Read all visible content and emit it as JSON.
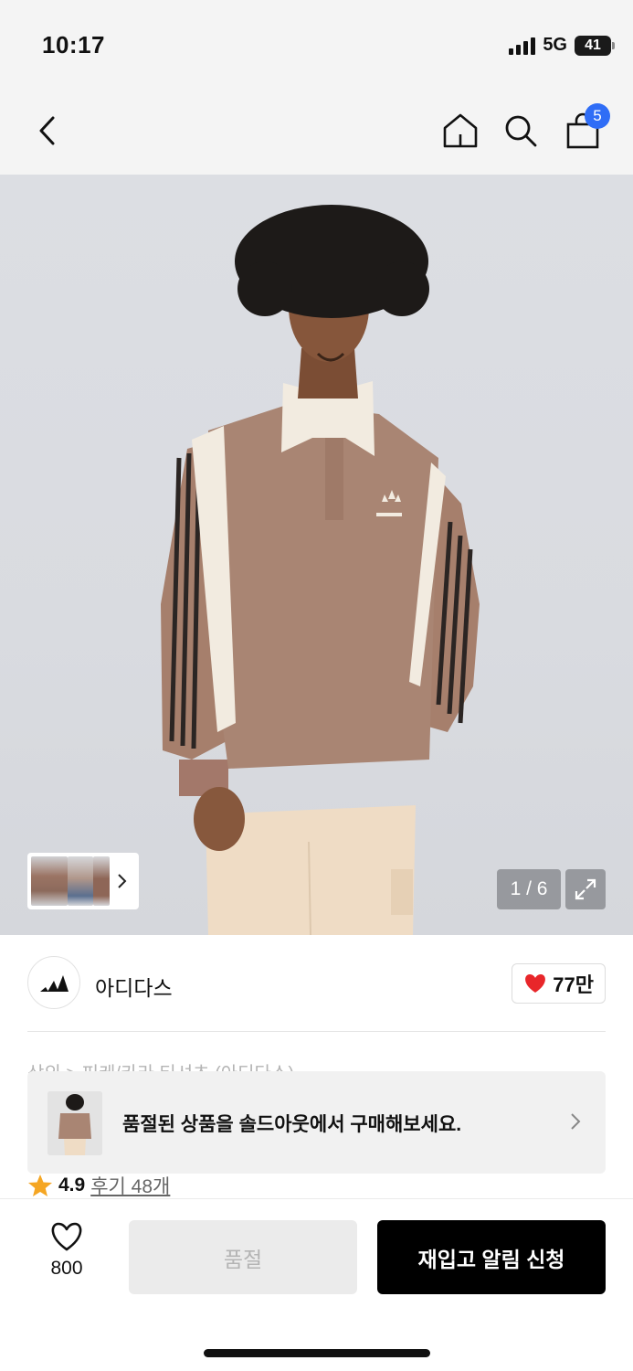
{
  "status_bar": {
    "time": "10:17",
    "network": "5G",
    "battery": "41"
  },
  "nav": {
    "back_icon": "chevron-left-icon",
    "home_icon": "home-icon",
    "search_icon": "search-icon",
    "cart_icon": "shopping-bag-icon",
    "cart_count": "5"
  },
  "gallery": {
    "page_counter": "1 / 6",
    "expand_icon": "expand-icon",
    "thumb_arrow_icon": "chevron-right-icon"
  },
  "brand": {
    "name": "아디다스",
    "like_count": "77만",
    "like_icon": "heart-filled-icon"
  },
  "breadcrumb": "상의 > 피케/카라 티셔츠 (아디다스)",
  "soldout_banner": {
    "text": "품절된 상품을 솔드아웃에서 구매해보세요.",
    "arrow_icon": "chevron-right-icon"
  },
  "rating": {
    "score": "4.9",
    "reviews": "후기 48개",
    "star_icon": "star-icon"
  },
  "bottom_bar": {
    "wish_count": "800",
    "wish_icon": "heart-outline-icon",
    "soldout_label": "품절",
    "restock_label": "재입고 알림 신청"
  },
  "colors": {
    "accent_blue": "#2f6df6",
    "heart_red": "#e8262a",
    "star_orange": "#f5a623",
    "primary_black": "#000000"
  }
}
